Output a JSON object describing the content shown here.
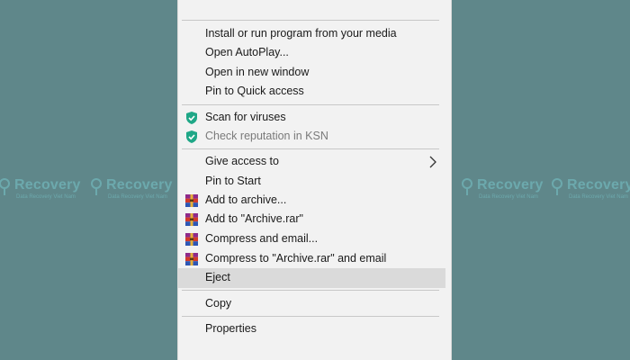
{
  "watermark": {
    "brand": "Recovery",
    "tagline": "Data Recovery Viet Nam"
  },
  "menu": {
    "items": [
      {
        "label": "Install or run program from your media",
        "icon": ""
      },
      {
        "label": "Open AutoPlay...",
        "icon": ""
      },
      {
        "label": "Open in new window",
        "icon": ""
      },
      {
        "label": "Pin to Quick access",
        "icon": ""
      },
      {
        "label": "Scan for viruses",
        "icon": "kaspersky-shield-icon"
      },
      {
        "label": "Check reputation in KSN",
        "icon": "kaspersky-shield-icon",
        "disabled": true
      },
      {
        "label": "Give access to",
        "icon": "",
        "submenu": true
      },
      {
        "label": "Pin to Start",
        "icon": ""
      },
      {
        "label": "Add to archive...",
        "icon": "winrar-icon"
      },
      {
        "label": "Add to \"Archive.rar\"",
        "icon": "winrar-icon"
      },
      {
        "label": "Compress and email...",
        "icon": "winrar-icon"
      },
      {
        "label": "Compress to \"Archive.rar\" and email",
        "icon": "winrar-icon"
      },
      {
        "label": "Eject",
        "icon": "",
        "highlighted": true
      },
      {
        "label": "Copy",
        "icon": ""
      },
      {
        "label": "Properties",
        "icon": ""
      }
    ]
  },
  "colors": {
    "background": "#5f878a",
    "menu_bg": "#f2f2f2",
    "highlight": "#dadada",
    "shield": "#1fa787",
    "text": "#1a1a1a",
    "disabled_text": "#7a7a7a"
  }
}
